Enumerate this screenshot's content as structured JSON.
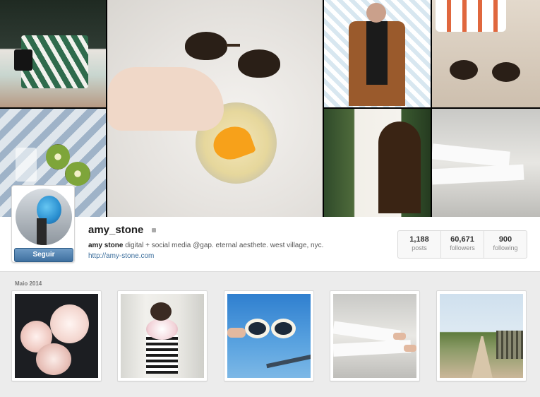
{
  "profile": {
    "username": "amy_stone",
    "verified_icon": "small-square-icon",
    "bio_name": "amy stone",
    "bio_text": " digital + social media @gap. eternal aesthete. west village, nyc.",
    "website": "http://amy-stone.com",
    "follow_label": "Seguir"
  },
  "stats": [
    {
      "value": "1,188",
      "label": "posts"
    },
    {
      "value": "60,671",
      "label": "followers"
    },
    {
      "value": "900",
      "label": "following"
    }
  ],
  "photos_section": {
    "date_label": "Maio 2014"
  },
  "colors": {
    "follow_button": "#4f80b0",
    "link": "#3b6e9c",
    "background": "#ececec"
  }
}
